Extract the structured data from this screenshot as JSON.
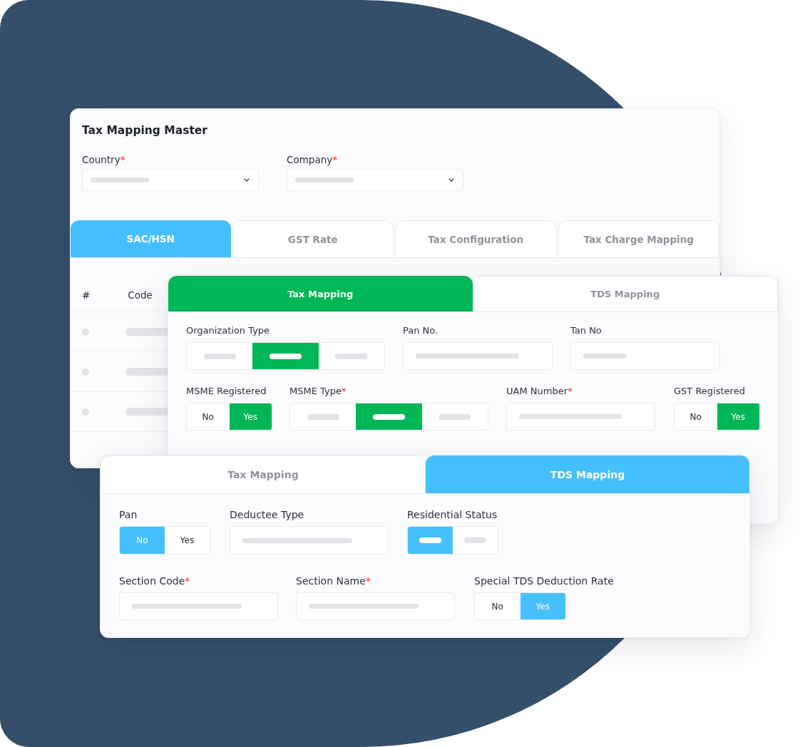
{
  "master_card": {
    "title": "Tax Mapping Master",
    "fields": [
      {
        "kind": "select",
        "label": "Country",
        "required_mark": "*"
      },
      {
        "kind": "select",
        "label": "Company",
        "required_mark": "*"
      }
    ],
    "tabs": [
      {
        "label": "SAC/HSN",
        "selected": true
      },
      {
        "label": "GST Rate",
        "selected": false
      },
      {
        "label": "Tax Configuration",
        "selected": false
      },
      {
        "label": "Tax Charge Mapping",
        "selected": false
      }
    ],
    "table": {
      "columns": [
        "#",
        "Code"
      ]
    }
  },
  "tax_mapping_card": {
    "tabs": [
      {
        "label": "Tax Mapping",
        "selected": true
      },
      {
        "label": "TDS Mapping",
        "selected": false
      }
    ],
    "rows": [
      {
        "fields": [
          {
            "kind": "segmented",
            "label": "Organization Type",
            "options": [
              {
                "selected": false
              },
              {
                "selected": true
              },
              {
                "selected": false
              }
            ]
          },
          {
            "kind": "input",
            "label": "Pan No."
          },
          {
            "kind": "input",
            "label": "Tan No"
          }
        ]
      },
      {
        "fields": [
          {
            "kind": "toggle",
            "label": "MSME Registered",
            "options": [
              {
                "label": "No",
                "selected": false
              },
              {
                "label": "Yes",
                "selected": true
              }
            ]
          },
          {
            "kind": "segmented",
            "label": "MSME Type",
            "required_mark": "*",
            "options": [
              {
                "selected": false
              },
              {
                "selected": true
              },
              {
                "selected": false
              }
            ]
          },
          {
            "kind": "input",
            "label": "UAM Number",
            "required_mark": "*"
          },
          {
            "kind": "toggle",
            "label": "GST Registered",
            "options": [
              {
                "label": "No",
                "selected": false
              },
              {
                "label": "Yes",
                "selected": true
              }
            ]
          }
        ]
      }
    ]
  },
  "tds_mapping_card": {
    "tabs": [
      {
        "label": "Tax Mapping",
        "selected": false
      },
      {
        "label": "TDS Mapping",
        "selected": true
      }
    ],
    "rows": [
      {
        "fields": [
          {
            "kind": "toggle",
            "label": "Pan",
            "options": [
              {
                "label": "No",
                "selected": true
              },
              {
                "label": "Yes",
                "selected": false
              }
            ]
          },
          {
            "kind": "input",
            "label": "Deductee Type"
          },
          {
            "kind": "segmented",
            "label": "Residential Status",
            "options": [
              {
                "selected": true
              },
              {
                "selected": false
              }
            ]
          }
        ]
      },
      {
        "fields": [
          {
            "kind": "input",
            "label": "Section Code",
            "required_mark": "*"
          },
          {
            "kind": "input",
            "label": "Section Name",
            "required_mark": "*"
          },
          {
            "kind": "toggle",
            "label": "Special TDS Deduction Rate",
            "options": [
              {
                "label": "No",
                "selected": false
              },
              {
                "label": "Yes",
                "selected": true
              }
            ]
          }
        ]
      }
    ]
  }
}
